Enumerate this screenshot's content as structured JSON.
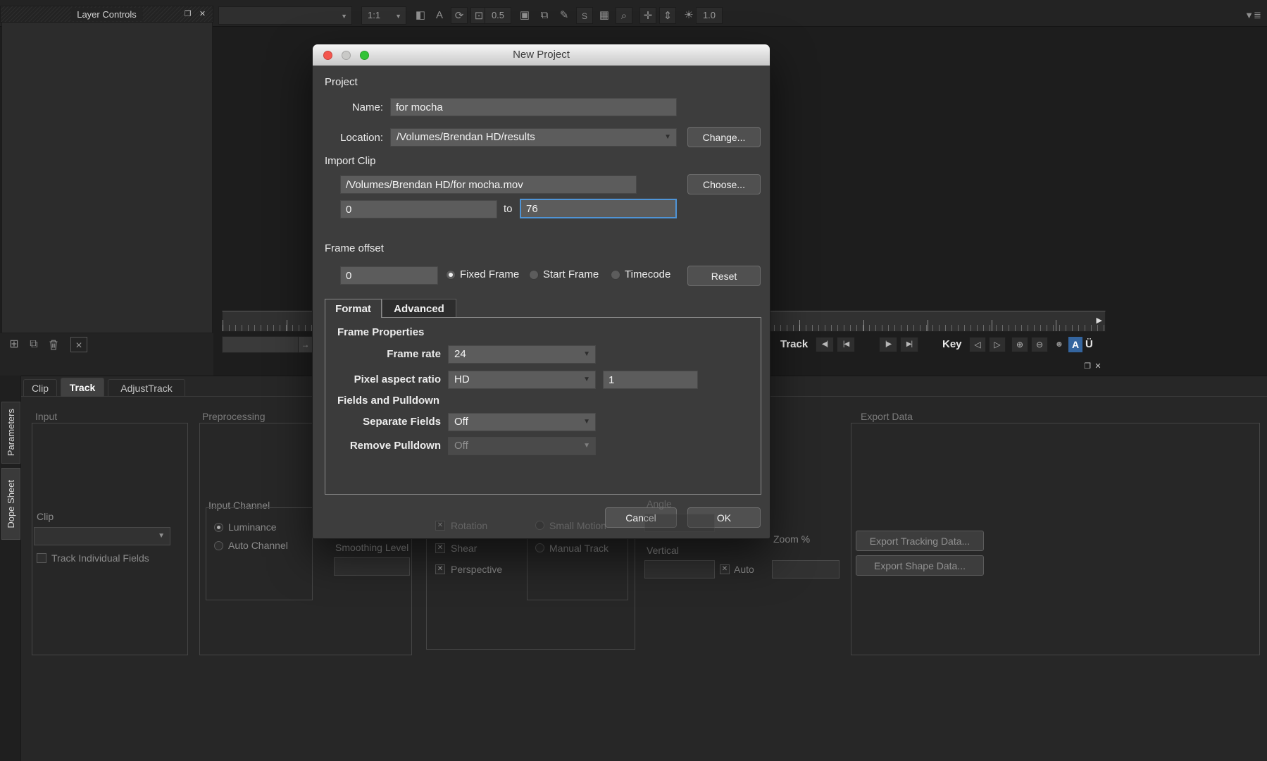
{
  "topbar": {
    "layer_controls_title": "Layer Controls",
    "view_combo": "",
    "zoom_combo": "1:1",
    "gain_value": "0.5",
    "exposure_value": "1.0"
  },
  "transport": {
    "track_label": "Track",
    "key_label": "Key",
    "annotate_label": "A",
    "uberkey_label": "Ü"
  },
  "dialog": {
    "title": "New Project",
    "project": {
      "section_label": "Project",
      "name_label": "Name:",
      "name_value": "for mocha",
      "location_label": "Location:",
      "location_value": "/Volumes/Brendan HD/results",
      "change_button": "Change..."
    },
    "import_clip": {
      "section_label": "Import Clip",
      "path_value": "/Volumes/Brendan HD/for mocha.mov",
      "choose_button": "Choose...",
      "in_value": "0",
      "to_label": "to",
      "out_value": "76"
    },
    "frame_offset": {
      "section_label": "Frame offset",
      "offset_value": "0",
      "fixed_frame_label": "Fixed Frame",
      "start_frame_label": "Start Frame",
      "timecode_label": "Timecode",
      "selected": "Fixed Frame",
      "reset_button": "Reset"
    },
    "tabs": {
      "format": "Format",
      "advanced": "Advanced",
      "active": "Format"
    },
    "format": {
      "frame_properties_header": "Frame Properties",
      "frame_rate_label": "Frame rate",
      "frame_rate_value": "24",
      "pixel_aspect_label": "Pixel aspect ratio",
      "pixel_aspect_value": "HD",
      "pixel_aspect_num": "1",
      "fields_header": "Fields and Pulldown",
      "separate_fields_label": "Separate Fields",
      "separate_fields_value": "Off",
      "remove_pulldown_label": "Remove Pulldown",
      "remove_pulldown_value": "Off",
      "remove_pulldown_disabled": true
    },
    "cancel_button": "Cancel",
    "ok_button": "OK",
    "colors": {
      "focus_border": "#4f94d6",
      "titlebar_close": "#f4564e",
      "titlebar_minimize": "#c9c9c7",
      "titlebar_zoom": "#32c337"
    }
  },
  "lower_panel": {
    "side_tabs": {
      "parameters": "Parameters",
      "dope_sheet": "Dope Sheet"
    },
    "tabs": {
      "clip": "Clip",
      "track": "Track",
      "adjust_track": "AdjustTrack",
      "active": "Track"
    },
    "input_group": {
      "title": "Input",
      "clip_label": "Clip",
      "clip_value": "",
      "track_individual_fields_label": "Track Individual Fields",
      "track_individual_fields_checked": false
    },
    "preprocessing_group": {
      "title": "Preprocessing",
      "input_channel_label": "Input Channel",
      "luminance_label": "Luminance",
      "auto_channel_label": "Auto Channel",
      "selected_channel": "Luminance",
      "smoothing_level_label": "Smoothing Level",
      "smoothing_level_value": ""
    },
    "motion_group": {
      "rotation_label": "Rotation",
      "shear_label": "Shear",
      "perspective_label": "Perspective",
      "checked": [
        "Rotation",
        "Shear",
        "Perspective"
      ],
      "small_motion_label": "Small Motion",
      "manual_track_label": "Manual Track"
    },
    "params": {
      "angle_label": "Angle",
      "angle_value": "",
      "vertical_label": "Vertical",
      "vertical_value": "",
      "zoom_label": "Zoom %",
      "zoom_value": "",
      "auto_label": "Auto",
      "auto_checked": true
    },
    "export_group": {
      "title": "Export Data",
      "export_tracking_button": "Export Tracking Data...",
      "export_shape_button": "Export Shape Data..."
    }
  },
  "icons": {
    "restore": "❐",
    "close": "✕",
    "dropdown_arrow": "▼",
    "split_view": "◧",
    "text_tool": "A",
    "refresh": "⟳",
    "lock": "⊡",
    "monitor": "▣",
    "layers": "⧉",
    "pen": "✎",
    "stabilize": "S",
    "grid": "▦",
    "magnifier": "⌕",
    "hand": "✛",
    "slider": "⇕",
    "brightness": "☀",
    "menu": "▼≣",
    "add_layer": "⊞",
    "duplicate_layer": "⧉",
    "deselect": "✕",
    "arrow_right": "→",
    "jump_back": "|◀",
    "step_back": "◀|",
    "step_fwd": "|▶",
    "jump_fwd": "▶|",
    "key_prev": "◁",
    "key_next": "▷",
    "key_add": "⊕",
    "key_del": "⊖",
    "person": "☻",
    "check": "✕",
    "ruler_marker": "▶"
  }
}
